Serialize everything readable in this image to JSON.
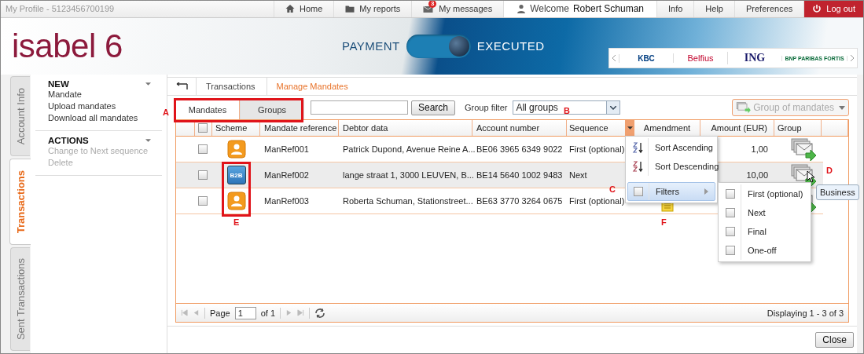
{
  "top_bar": {
    "profile": "My Profile - 5123456700199",
    "nav": [
      {
        "kind": "home",
        "label": "Home"
      },
      {
        "kind": "reports",
        "label": "My reports"
      },
      {
        "kind": "messages",
        "label": "My messages",
        "badge": "3"
      },
      {
        "kind": "user",
        "label": "Welcome",
        "user": "Robert Schuman"
      },
      {
        "kind": "plain",
        "label": "Info"
      },
      {
        "kind": "plain",
        "label": "Help"
      },
      {
        "kind": "plain",
        "label": "Preferences"
      },
      {
        "kind": "logout",
        "label": "Log out"
      }
    ]
  },
  "banner": {
    "logo": "isabel 6",
    "toggle_left": "PAYMENT",
    "toggle_on": true,
    "toggle_right": "EXECUTED",
    "banks": [
      {
        "kind": "kbc",
        "label": "KBC"
      },
      {
        "kind": "belfius",
        "label": "Belfius"
      },
      {
        "kind": "ing",
        "label": "ING"
      },
      {
        "kind": "bnp",
        "label": "BNP PARIBAS FORTIS"
      }
    ]
  },
  "side_tabs": [
    {
      "label": "Account Info",
      "selected": false
    },
    {
      "label": "Transactions",
      "selected": true
    },
    {
      "label": "Sent Transactions",
      "selected": false
    }
  ],
  "sidebar": [
    {
      "title": "NEW",
      "items": [
        {
          "label": "Mandate",
          "disabled": false
        },
        {
          "label": "Upload mandates",
          "disabled": false
        },
        {
          "label": "Download all mandates",
          "disabled": false
        }
      ]
    },
    {
      "title": "ACTIONS",
      "items": [
        {
          "label": "Change to Next sequence",
          "disabled": true
        },
        {
          "label": "Delete",
          "disabled": true
        }
      ]
    }
  ],
  "breadcrumb": [
    {
      "label": "Transactions",
      "selected": false
    },
    {
      "label": "Manage Mandates",
      "selected": true
    }
  ],
  "tabs": [
    {
      "label": "Mandates",
      "selected": true
    },
    {
      "label": "Groups",
      "selected": false
    }
  ],
  "search": {
    "button": "Search"
  },
  "group_filter": {
    "label": "Group filter",
    "value": "All groups"
  },
  "group_button": {
    "label": "Group of mandates",
    "disabled": true
  },
  "table": {
    "all_checked": false,
    "columns": [
      "Scheme",
      "Mandate reference",
      "Debtor data",
      "Account number",
      "Sequence",
      "Amendment",
      "Amount (EUR)",
      "Group"
    ],
    "rows": [
      {
        "selected": false,
        "checked": false,
        "scheme": {
          "kind": "core"
        },
        "reference": "ManRef001",
        "debtor": "Patrick Dupond, Avenue Reine A...",
        "account": "BE06 3965 6349 9022",
        "sequence": "First (optional)",
        "amount": "1,00"
      },
      {
        "selected": true,
        "checked": false,
        "scheme": {
          "kind": "b2b",
          "label": "B2B"
        },
        "reference": "ManRef002",
        "debtor": "lange straat 1, 3000 LEUVEN, B...",
        "account": "BE14 5640 1002 9483",
        "sequence": "Next",
        "amount": "10,00"
      },
      {
        "selected": false,
        "checked": false,
        "scheme": {
          "kind": "core"
        },
        "reference": "ManRef003",
        "debtor": "Roberta Schuman, Stationstreet...",
        "account": "BE63 3770 3264 0675",
        "sequence": "First (optional)",
        "amendment": true
      }
    ]
  },
  "sort_menu": [
    {
      "kind": "asc",
      "label": "Sort Ascending"
    },
    {
      "kind": "desc",
      "label": "Sort Descending"
    },
    {
      "kind": "filters",
      "label": "Filters",
      "checked": false,
      "selected": true
    }
  ],
  "filter_menu": [
    {
      "label": "First (optional)",
      "checked": false
    },
    {
      "label": "Next",
      "checked": false
    },
    {
      "label": "Final",
      "checked": false
    },
    {
      "label": "One-off",
      "checked": false
    }
  ],
  "tooltip": "Business",
  "pager": {
    "page_label": "Page",
    "page": "1",
    "of": "of 1",
    "display": "Displaying 1 - 3 of 3"
  },
  "annotations": [
    "A",
    "B",
    "C",
    "D",
    "E",
    "F"
  ],
  "close_button": "Close"
}
